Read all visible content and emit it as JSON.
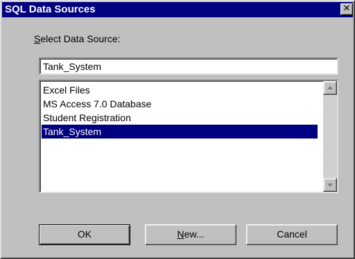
{
  "window": {
    "title": "SQL Data Sources",
    "close_glyph": "✕",
    "close_icon": "close-icon"
  },
  "form": {
    "label_accel": "S",
    "label_rest": "elect Data Source:",
    "input_value": "Tank_System"
  },
  "list": {
    "items": [
      {
        "label": "Excel Files"
      },
      {
        "label": "MS Access 7.0 Database"
      },
      {
        "label": "Student Registration"
      },
      {
        "label": "Tank_System",
        "selected": true
      }
    ],
    "scroll_up_icon": "scroll-up-arrow-icon",
    "scroll_down_icon": "scroll-down-arrow-icon"
  },
  "buttons": {
    "ok": "OK",
    "new_accel": "N",
    "new_rest": "ew...",
    "cancel": "Cancel"
  },
  "colors": {
    "titlebar": "#000080",
    "face": "#c0c0c0",
    "selection": "#000080"
  }
}
